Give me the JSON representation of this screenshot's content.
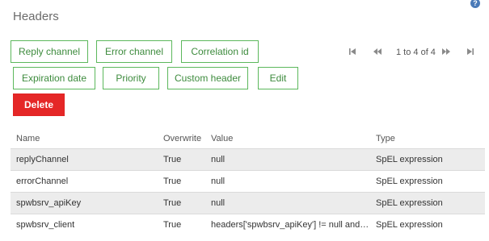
{
  "header": {
    "title": "Headers"
  },
  "toolbar": {
    "reply_channel": "Reply channel",
    "error_channel": "Error channel",
    "correlation_id": "Correlation id",
    "expiration_date": "Expiration date",
    "priority": "Priority",
    "custom_header": "Custom header",
    "edit": "Edit",
    "delete": "Delete"
  },
  "pagination": {
    "text": "1 to 4 of 4"
  },
  "table": {
    "columns": [
      "Name",
      "Overwrite",
      "Value",
      "Type"
    ],
    "rows": [
      [
        "replyChannel",
        "True",
        "null",
        "SpEL expression"
      ],
      [
        "errorChannel",
        "True",
        "null",
        "SpEL expression"
      ],
      [
        "spwbsrv_apiKey",
        "True",
        "null",
        "SpEL expression"
      ],
      [
        "spwbsrv_client",
        "True",
        "headers['spwbsrv_apiKey'] != null and {$...",
        "SpEL expression"
      ]
    ]
  },
  "colors": {
    "accent": "#5cb85c",
    "danger": "#e52727",
    "row_alt": "#ececec"
  },
  "icons": {
    "help": "help-icon",
    "first": "first-page-icon",
    "prev": "prev-page-icon",
    "next": "next-page-icon",
    "last": "last-page-icon"
  }
}
